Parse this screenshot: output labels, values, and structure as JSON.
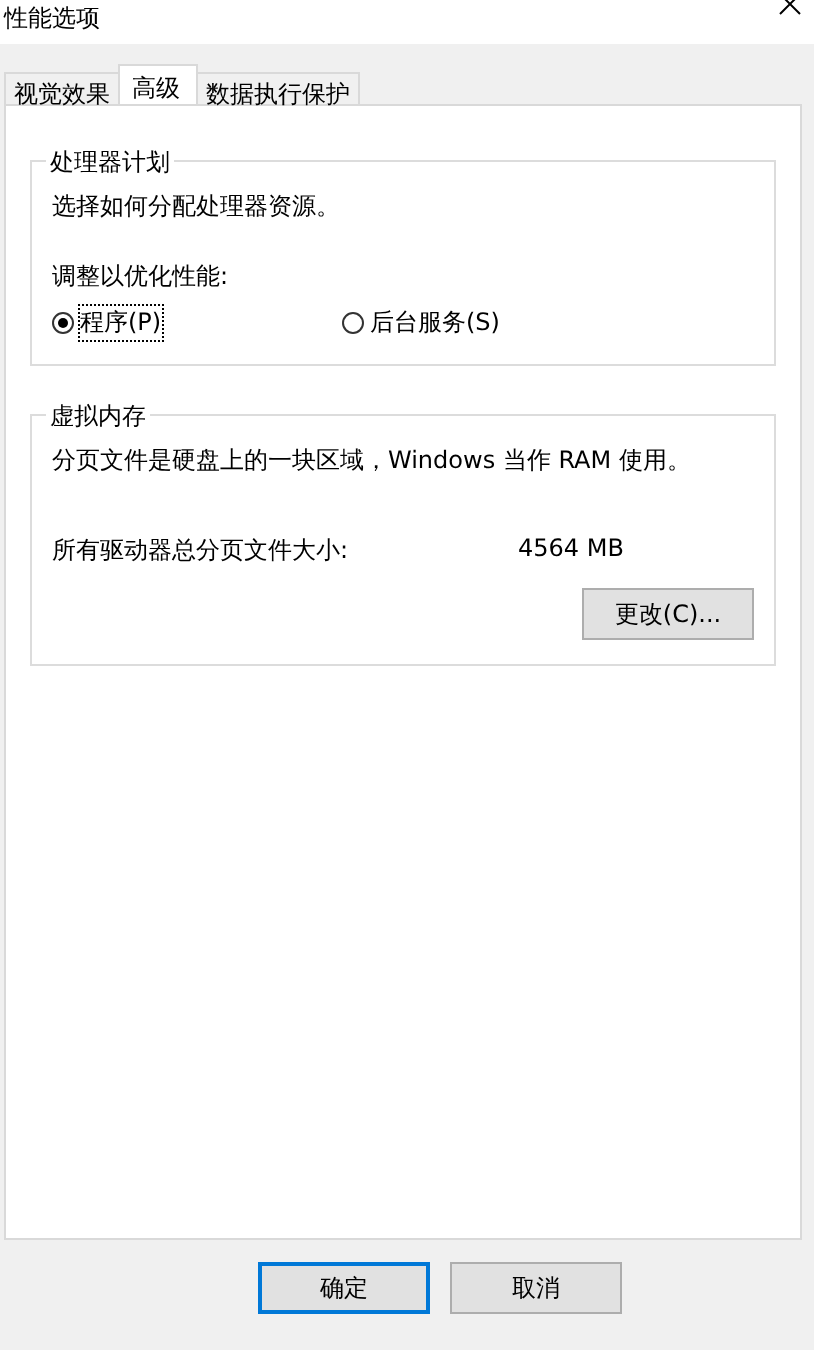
{
  "window": {
    "title": "性能选项"
  },
  "tabs": [
    {
      "label": "视觉效果",
      "selected": false
    },
    {
      "label": "高级",
      "selected": true
    },
    {
      "label": "数据执行保护",
      "selected": false
    }
  ],
  "processor_scheduling": {
    "title": "处理器计划",
    "description": "选择如何分配处理器资源。",
    "prompt": "调整以优化性能:",
    "options": [
      {
        "label": "程序(P)",
        "selected": true
      },
      {
        "label": "后台服务(S)",
        "selected": false
      }
    ]
  },
  "virtual_memory": {
    "title": "虚拟内存",
    "description": "分页文件是硬盘上的一块区域，Windows 当作 RAM 使用。",
    "total_label": "所有驱动器总分页文件大小:",
    "total_value": "4564 MB",
    "change_button": "更改(C)..."
  },
  "buttons": [
    {
      "label": "确定",
      "default": true
    },
    {
      "label": "取消",
      "default": false
    }
  ]
}
